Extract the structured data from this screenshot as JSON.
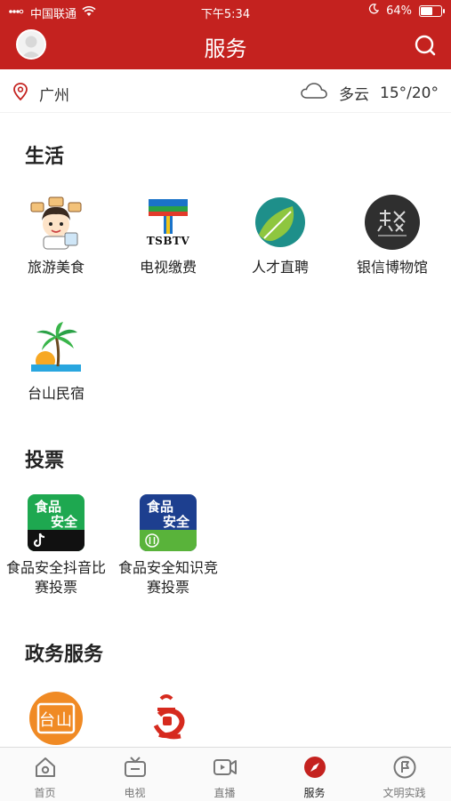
{
  "status_bar": {
    "carrier": "中国联通",
    "time": "下午5:34",
    "battery_percent": "64%",
    "battery_level": 0.64
  },
  "header": {
    "title": "服务"
  },
  "info_bar": {
    "location": "广州",
    "weather_desc": "多云",
    "temperature": "15°/20°"
  },
  "sections": {
    "life": {
      "title": "生活",
      "items": [
        {
          "label": "旅游美食",
          "icon": "travel-food-icon"
        },
        {
          "label": "电视缴费",
          "icon": "tsbtv-logo"
        },
        {
          "label": "人才直聘",
          "icon": "talent-leaf-icon"
        },
        {
          "label": "银信博物馆",
          "icon": "museum-icon"
        },
        {
          "label": "台山民宿",
          "icon": "palm-tree-icon"
        }
      ]
    },
    "vote": {
      "title": "投票",
      "items": [
        {
          "label": "食品安全抖音比赛投票",
          "icon": "food-safety-tiktok-icon",
          "icon_text_top": "食品",
          "icon_text_bottom": "安全"
        },
        {
          "label": "食品安全知识竞赛投票",
          "icon": "food-safety-quiz-icon",
          "icon_text_top": "食品",
          "icon_text_bottom": "安全"
        }
      ]
    },
    "gov": {
      "title": "政务服务",
      "items": [
        {
          "label": "",
          "icon": "taishan-logo",
          "icon_text": "台山"
        },
        {
          "label": "",
          "icon": "red-emblem-icon"
        }
      ]
    }
  },
  "logos": {
    "tsbtv_text": "TSBTV"
  },
  "tabbar": {
    "items": [
      {
        "label": "首页",
        "icon": "home-icon"
      },
      {
        "label": "电视",
        "icon": "tv-icon"
      },
      {
        "label": "直播",
        "icon": "live-icon"
      },
      {
        "label": "服务",
        "icon": "compass-icon",
        "active": true
      },
      {
        "label": "文明实践",
        "icon": "flag-icon"
      }
    ]
  },
  "colors": {
    "brand_red": "#c4221f",
    "food_green": "#1ea850",
    "food_blue": "#1d3f8f"
  }
}
